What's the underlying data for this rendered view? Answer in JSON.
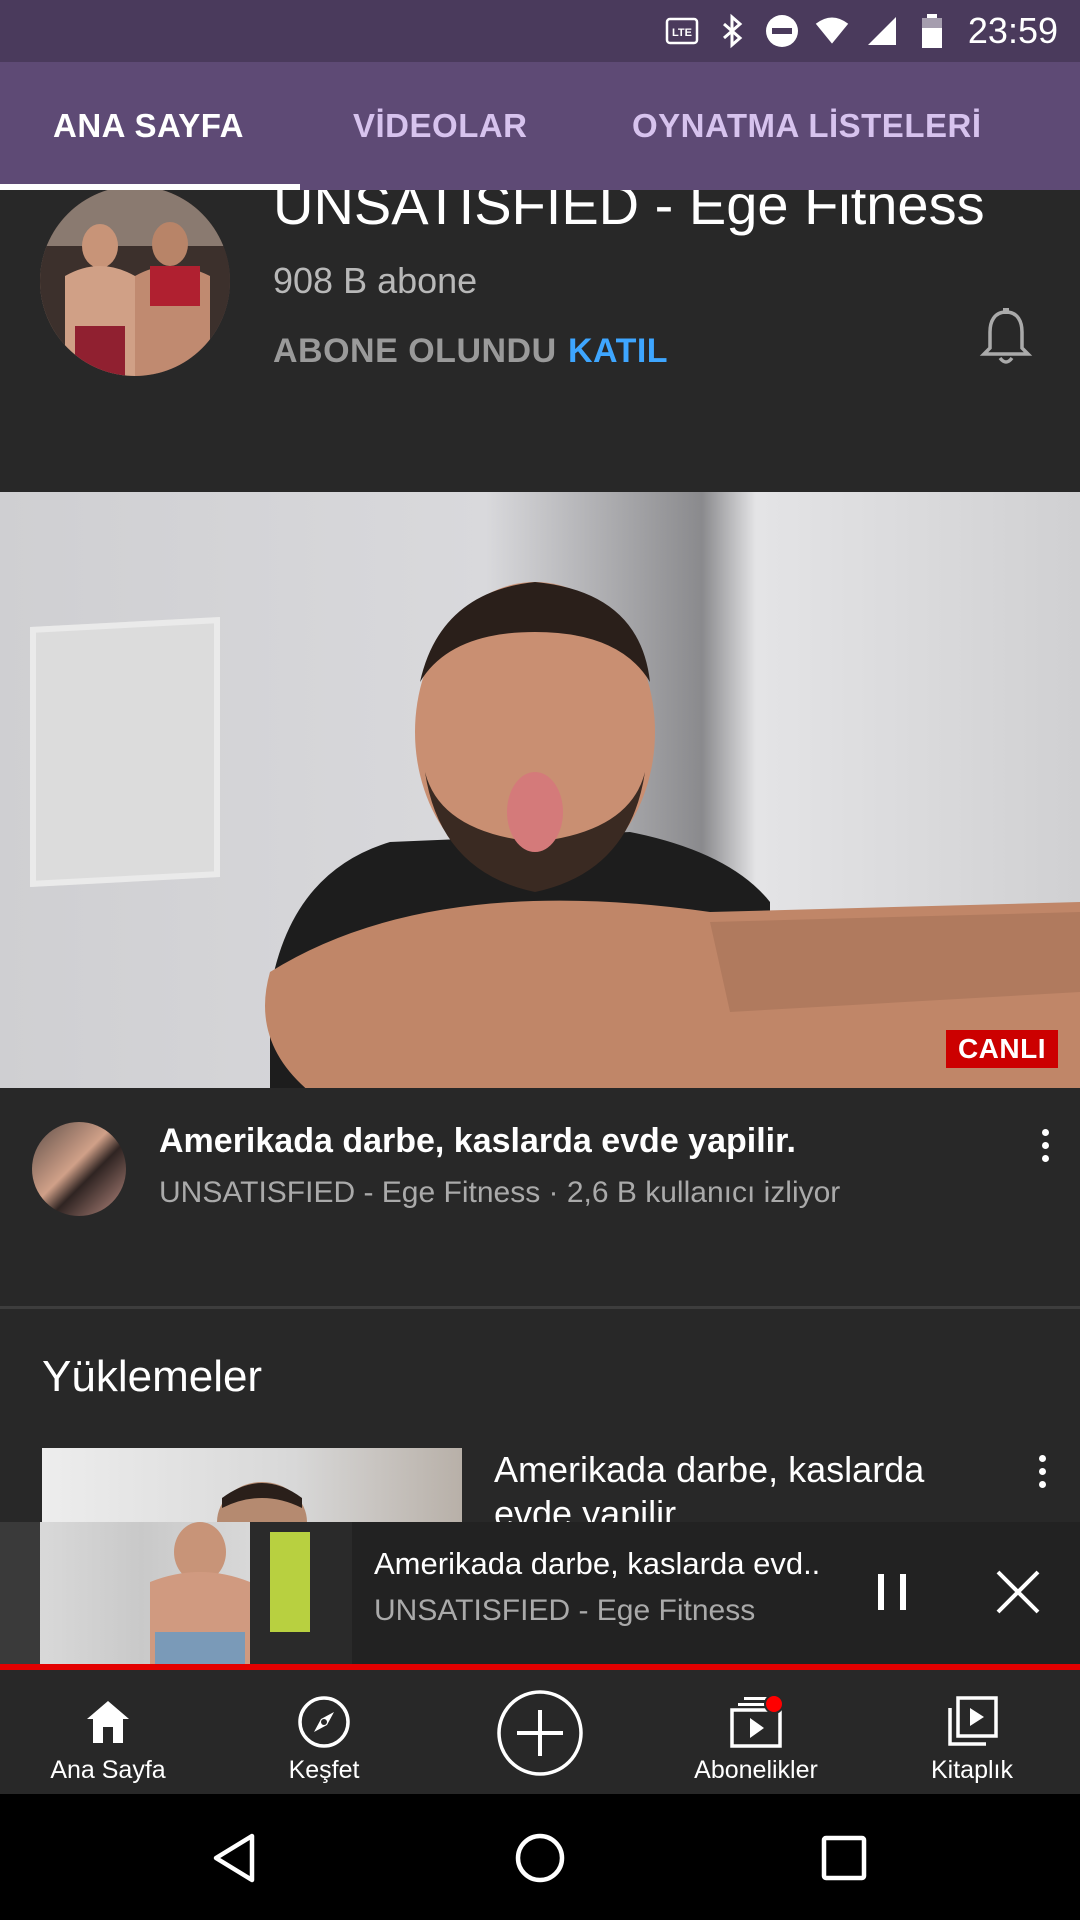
{
  "status_bar": {
    "time": "23:59",
    "icons": [
      "volte-icon",
      "bluetooth-icon",
      "dnd-icon",
      "wifi-icon",
      "signal-icon",
      "battery-icon"
    ]
  },
  "tabs": [
    {
      "label": "ANA SAYFA",
      "active": true
    },
    {
      "label": "VİDEOLAR",
      "active": false
    },
    {
      "label": "OYNATMA LİSTELERİ",
      "active": false
    }
  ],
  "channel": {
    "name": "UNSATISFIED - Ege Fitness",
    "subscribers": "908 B abone",
    "subscribed_label": "ABONE OLUNDU",
    "join_label": "KATIL"
  },
  "featured": {
    "badge": "CANLI",
    "title": "Amerikada darbe, kaslarda evde yapilir.",
    "meta": "UNSATISFIED - Ege Fitness · 2,6 B kullanıcı izliyor"
  },
  "uploads": {
    "section_title": "Yüklemeler",
    "items": [
      {
        "title": "Amerikada darbe, kaslarda evde yapilir."
      }
    ]
  },
  "mini_player": {
    "title": "Amerikada darbe, kaslarda evd..",
    "channel": "UNSATISFIED - Ege Fitness"
  },
  "bottom_nav": [
    {
      "label": "Ana Sayfa",
      "icon": "home-icon"
    },
    {
      "label": "Keşfet",
      "icon": "explore-icon"
    },
    {
      "label": "",
      "icon": "create-icon"
    },
    {
      "label": "Abonelikler",
      "icon": "subscriptions-icon"
    },
    {
      "label": "Kitaplık",
      "icon": "library-icon"
    }
  ],
  "colors": {
    "status_bar": "#4a3a5c",
    "tab_bar": "#5e4a75",
    "background": "#282828",
    "accent_blue": "#3ea6ff",
    "live_red": "#cc0000"
  }
}
